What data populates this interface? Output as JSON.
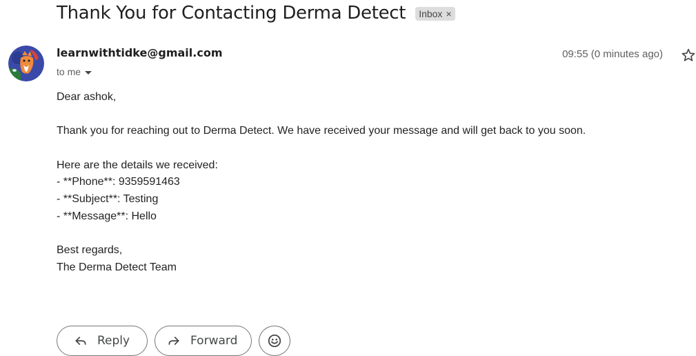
{
  "email": {
    "subject": "Thank You for Contacting Derma Detect",
    "label": {
      "text": "Inbox",
      "remove_glyph": "×"
    },
    "sender": "learnwithtidke@gmail.com",
    "recipient_text": "to me",
    "time": "09:55 (0 minutes ago)",
    "body_lines": [
      "Dear ashok,",
      "",
      "Thank you for reaching out to Derma Detect. We have received your message and will get back to you soon.",
      "",
      "Here are the details we received:",
      "- **Phone**: 9359591463",
      "- **Subject**: Testing",
      "- **Message**: Hello",
      "",
      "Best regards,",
      "The Derma Detect Team"
    ]
  },
  "actions": {
    "reply_label": "Reply",
    "forward_label": "Forward"
  },
  "icons": {
    "avatar": "fox-avatar-icon",
    "recipient_details": "chevron-down-icon",
    "star": "star-icon",
    "reply": "reply-arrow-icon",
    "forward": "forward-arrow-icon",
    "emoji": "smiley-face-icon"
  },
  "colors": {
    "label_chip_bg": "#dddddd",
    "avatar_bg": "#3b4aa8",
    "avatar_fox": "#f08a3c",
    "button_border": "#747775"
  }
}
